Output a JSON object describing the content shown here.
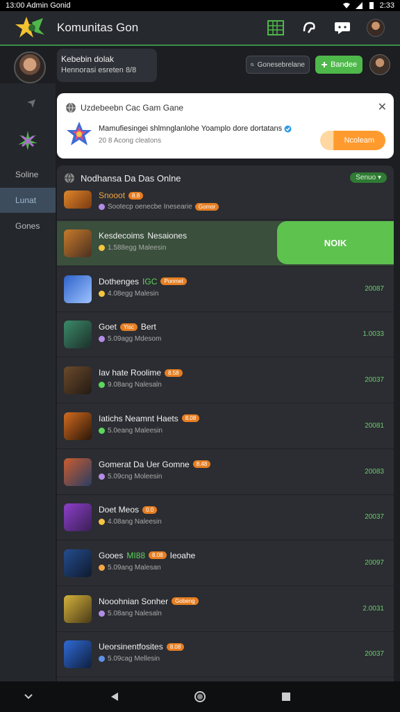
{
  "status": {
    "left_text": "13:00 Admin Gonid",
    "time": "2:33"
  },
  "app": {
    "title": "Komunitas Gon"
  },
  "profile": {
    "name": "Kebebin dolak",
    "sub": "Hennorasi esreten 8/8",
    "search_placeholder": "Gonesebrelane",
    "follow_label": "Bandee"
  },
  "sidebar": {
    "items": [
      {
        "label": "Soline"
      },
      {
        "label": "Lunat"
      },
      {
        "label": "Gones"
      }
    ]
  },
  "notification": {
    "header": "Uzdebeebn Cac Gam Gane",
    "message": "Mamufiesingei shlmnglanlohe Yoamplo dore dortatans",
    "meta": "20 8 Acong cleatons",
    "cta_label": "Ncoleam"
  },
  "list": {
    "title": "Nodhansa Da Das Onlne",
    "badge": "Senuo",
    "first": {
      "title": "Snooot",
      "tag": "8.8",
      "meta": "Sootecp oenecbe Inesearie",
      "meta_tag": "Gomor"
    },
    "rows": [
      {
        "title": "Kesdecoims",
        "title_extra": "Nesaiones",
        "meta": "1.588egg Maleesin",
        "join_label": "NOIK",
        "dot_color": "#f5c542",
        "icon_colors": [
          "#c77a2a",
          "#4a3020"
        ]
      },
      {
        "title": "Dothenges",
        "title_green": "IGC",
        "tag": "Ponmet",
        "meta": "4.08egg Malesin",
        "value": "20087",
        "dot_color": "#f5c542",
        "icon_colors": [
          "#2d62c9",
          "#9fc3ff"
        ]
      },
      {
        "title": "Goet",
        "tag": "Yisc",
        "title_extra": "Bert",
        "meta": "5.09agg Mdesom",
        "value": "1.0033",
        "dot_color": "#b28ce6",
        "icon_colors": [
          "#3b8a6a",
          "#1d2f2a"
        ]
      },
      {
        "title": "Iav hate Roolime",
        "tag": "8.58",
        "meta": "9.08ang Nalesaln",
        "value": "20037",
        "dot_color": "#5cd65c",
        "icon_colors": [
          "#6b4a2b",
          "#231a14"
        ]
      },
      {
        "title": "Iatichs Neamnt Haets",
        "tag": "8.08",
        "meta": "5.0eang Maleesin",
        "value": "20081",
        "dot_color": "#5cd65c",
        "icon_colors": [
          "#d36b1f",
          "#2a1608"
        ]
      },
      {
        "title": "Gomerat Da Uer Gomne",
        "tag": "8.48",
        "meta": "5.09cng Moleesin",
        "value": "20083",
        "dot_color": "#b28ce6",
        "icon_colors": [
          "#c95c2e",
          "#2b3d63"
        ]
      },
      {
        "title": "Doet Meos",
        "tag": "0.0",
        "meta": "4.08ang Naleesin",
        "value": "20037",
        "dot_color": "#f5c542",
        "icon_colors": [
          "#8c3fc9",
          "#3a1f55"
        ]
      },
      {
        "title": "Gooes",
        "title_green": "MI88",
        "title_extra": "Ieoahe",
        "tag": "8.08",
        "meta": "5.09ang Malesan",
        "value": "20097",
        "dot_color": "#f5a742",
        "icon_colors": [
          "#244d8f",
          "#0f1a2e"
        ]
      },
      {
        "title": "Nooohnian Sonher",
        "tag": "Gobeng",
        "meta": "5.08ang Nalesaln",
        "value": "2.0031",
        "dot_color": "#b28ce6",
        "icon_colors": [
          "#d4b23b",
          "#4a3a18"
        ]
      },
      {
        "title": "Ueorsinentfosites",
        "tag": "8.08",
        "meta": "5.09cag Mellesin",
        "value": "20037",
        "dot_color": "#5f8fe6",
        "icon_colors": [
          "#2f6ad6",
          "#0f1f3e"
        ]
      }
    ]
  }
}
